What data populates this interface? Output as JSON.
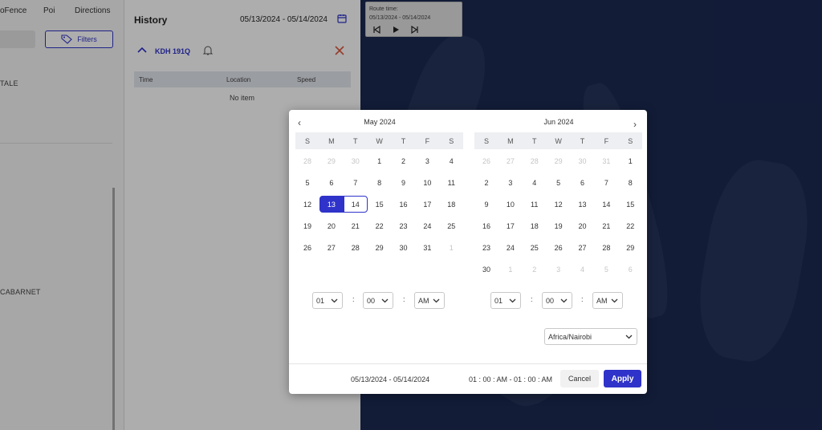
{
  "nav": {
    "geofence": "oFence",
    "poi": "Poi",
    "directions": "Directions"
  },
  "sidebar": {
    "filters_label": "Filters",
    "item1": "TALE",
    "item2": "CABARNET"
  },
  "history": {
    "title": "History",
    "date_range": "05/13/2024 - 05/14/2024",
    "vehicle": "KDH 191Q",
    "columns": [
      "Time",
      "Location",
      "Speed"
    ],
    "empty": "No item"
  },
  "route": {
    "label": "Route time:",
    "range": "05/13/2024 - 05/14/2024"
  },
  "colors": {
    "accent": "#2f33c9"
  },
  "datepicker": {
    "weekdays": [
      "S",
      "M",
      "T",
      "W",
      "T",
      "F",
      "S"
    ],
    "left": {
      "title": "May 2024",
      "weeks": [
        [
          "28",
          "29",
          "30",
          "1",
          "2",
          "3",
          "4"
        ],
        [
          "5",
          "6",
          "7",
          "8",
          "9",
          "10",
          "11"
        ],
        [
          "12",
          "13",
          "14",
          "15",
          "16",
          "17",
          "18"
        ],
        [
          "19",
          "20",
          "21",
          "22",
          "23",
          "24",
          "25"
        ],
        [
          "26",
          "27",
          "28",
          "29",
          "30",
          "31",
          "1"
        ]
      ]
    },
    "right": {
      "title": "Jun 2024",
      "weeks": [
        [
          "26",
          "27",
          "28",
          "29",
          "30",
          "31",
          "1"
        ],
        [
          "2",
          "3",
          "4",
          "5",
          "6",
          "7",
          "8"
        ],
        [
          "9",
          "10",
          "11",
          "12",
          "13",
          "14",
          "15"
        ],
        [
          "16",
          "17",
          "18",
          "19",
          "20",
          "21",
          "22"
        ],
        [
          "23",
          "24",
          "25",
          "26",
          "27",
          "28",
          "29"
        ],
        [
          "30",
          "1",
          "2",
          "3",
          "4",
          "5",
          "6"
        ]
      ]
    },
    "start_time": {
      "hour": "01",
      "minute": "00",
      "ampm": "AM"
    },
    "end_time": {
      "hour": "01",
      "minute": "00",
      "ampm": "AM"
    },
    "timezone": "Africa/Nairobi",
    "footer_range": "05/13/2024 - 05/14/2024",
    "footer_time": "01 : 00 : AM - 01 : 00 : AM",
    "cancel": "Cancel",
    "apply": "Apply"
  }
}
